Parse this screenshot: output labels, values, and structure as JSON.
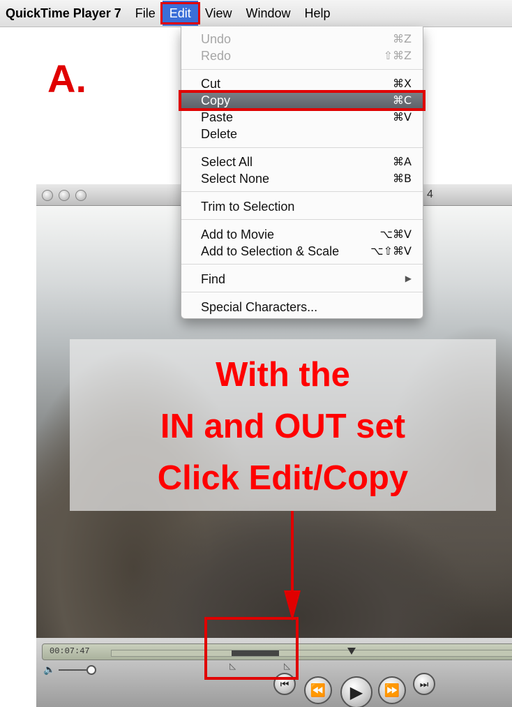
{
  "menubar": {
    "app_name": "QuickTime Player 7",
    "items": [
      "File",
      "Edit",
      "View",
      "Window",
      "Help"
    ],
    "active": "Edit"
  },
  "annotation": {
    "step_label": "A.",
    "overlay_lines": [
      "With the",
      "IN and OUT set",
      "Click Edit/Copy"
    ],
    "highlight_color": "#e00000"
  },
  "window": {
    "title_fragment": "4"
  },
  "controller": {
    "time": "00:07:47",
    "selection_in_fraction": 0.29,
    "selection_out_fraction": 0.4
  },
  "edit_menu": {
    "groups": [
      [
        {
          "label": "Undo",
          "shortcut": "⌘Z",
          "enabled": false
        },
        {
          "label": "Redo",
          "shortcut": "⇧⌘Z",
          "enabled": false
        }
      ],
      [
        {
          "label": "Cut",
          "shortcut": "⌘X",
          "enabled": true
        },
        {
          "label": "Copy",
          "shortcut": "⌘C",
          "enabled": true,
          "highlighted": true
        },
        {
          "label": "Paste",
          "shortcut": "⌘V",
          "enabled": true
        },
        {
          "label": "Delete",
          "shortcut": "",
          "enabled": true
        }
      ],
      [
        {
          "label": "Select All",
          "shortcut": "⌘A",
          "enabled": true
        },
        {
          "label": "Select None",
          "shortcut": "⌘B",
          "enabled": true
        }
      ],
      [
        {
          "label": "Trim to Selection",
          "shortcut": "",
          "enabled": true
        }
      ],
      [
        {
          "label": "Add to Movie",
          "shortcut": "⌥⌘V",
          "enabled": true
        },
        {
          "label": "Add to Selection & Scale",
          "shortcut": "⌥⇧⌘V",
          "enabled": true
        }
      ],
      [
        {
          "label": "Find",
          "shortcut": "▶",
          "enabled": true
        }
      ],
      [
        {
          "label": "Special Characters...",
          "shortcut": "",
          "enabled": true
        }
      ]
    ]
  }
}
